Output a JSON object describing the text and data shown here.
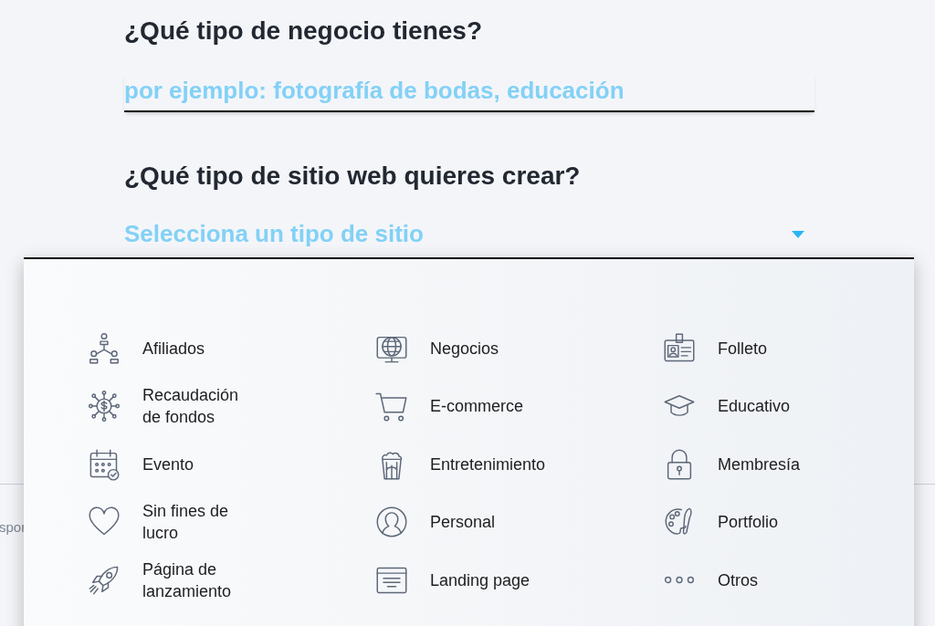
{
  "business_question": {
    "heading": "¿Qué tipo de negocio tienes?",
    "placeholder": "por ejemplo: fotografía de bodas, educación"
  },
  "site_question": {
    "heading": "¿Qué tipo de sitio web quieres crear?",
    "placeholder": "Selecciona un tipo de sitio",
    "expanded": true
  },
  "background_text": "spor",
  "options": [
    {
      "label": "Afiliados"
    },
    {
      "label": "Negocios"
    },
    {
      "label": "Folleto"
    },
    {
      "label": "Recaudación de fondos"
    },
    {
      "label": "E-commerce"
    },
    {
      "label": "Educativo"
    },
    {
      "label": "Evento"
    },
    {
      "label": "Entretenimiento"
    },
    {
      "label": "Membresía"
    },
    {
      "label": "Sin fines de lucro"
    },
    {
      "label": "Personal"
    },
    {
      "label": "Portfolio"
    },
    {
      "label": "Página de lanzamiento"
    },
    {
      "label": "Landing page"
    },
    {
      "label": "Otros"
    }
  ]
}
